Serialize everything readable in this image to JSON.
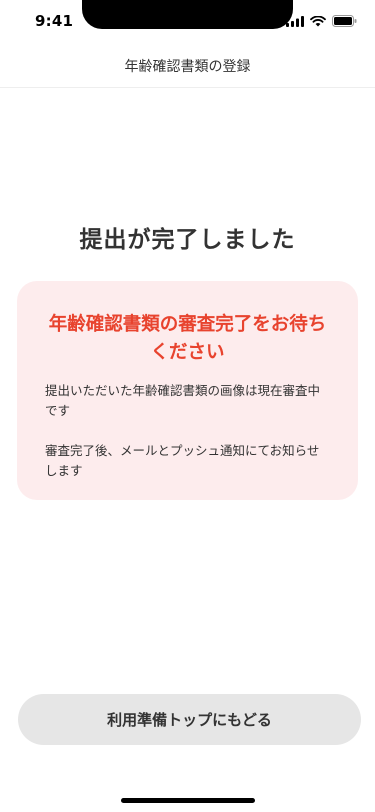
{
  "status_bar": {
    "time": "9:41"
  },
  "header": {
    "title": "年齢確認書類の登録"
  },
  "main": {
    "title": "提出が完了しました",
    "notice": {
      "heading": "年齢確認書類の審査完了をお待ちください",
      "lines": [
        "提出いただいた年齢確認書類の画像は現在審査中です",
        "審査完了後、メールとプッシュ通知にてお知らせします"
      ]
    },
    "button_label": "利用準備トップにもどる"
  },
  "colors": {
    "accent": "#e8432e",
    "card_background": "#fdeced",
    "button_background": "#e6e6e6"
  },
  "icons": [
    "signal-icon",
    "wifi-icon",
    "battery-icon"
  ]
}
